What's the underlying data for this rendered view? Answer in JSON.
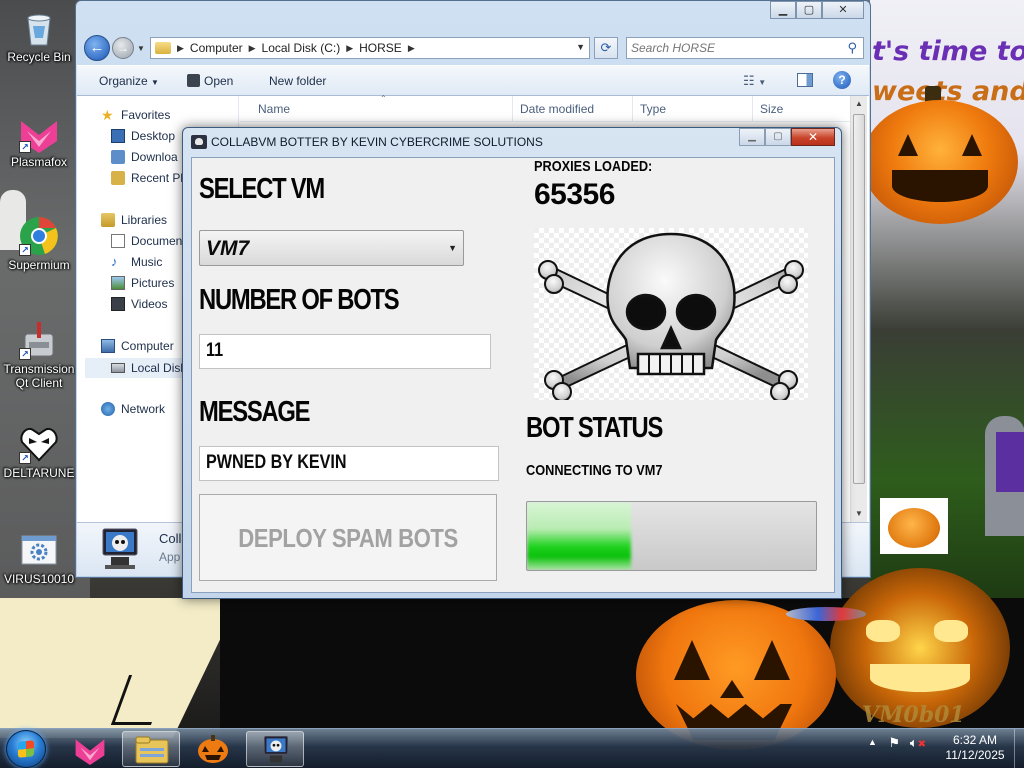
{
  "desktop": {
    "icons": [
      {
        "label": "Recycle Bin",
        "icon": "recycle-bin-icon"
      },
      {
        "label": "Plasmafox",
        "icon": "plasmafox-icon"
      },
      {
        "label": "Supermium",
        "icon": "supermium-icon"
      },
      {
        "label": "Transmission Qt Client",
        "icon": "transmission-icon"
      },
      {
        "label": "DELTARUNE",
        "icon": "deltarune-icon"
      },
      {
        "label": "VIRUS10010",
        "icon": "virus-program-icon"
      }
    ],
    "wallpaper_text": {
      "line1": "t's time to play pra",
      "line2": "weets and i",
      "watermark": "VM0b01"
    }
  },
  "explorer": {
    "address": {
      "segments": [
        "Computer",
        "Local Disk (C:)",
        "HORSE"
      ]
    },
    "search_placeholder": "Search HORSE",
    "toolbar": {
      "organize": "Organize",
      "open": "Open",
      "new_folder": "New folder"
    },
    "nav": {
      "favorites": "Favorites",
      "desktop": "Desktop",
      "downloads": "Downloa",
      "recent": "Recent Pl",
      "libraries": "Libraries",
      "documents": "Documen",
      "music": "Music",
      "pictures": "Pictures",
      "videos": "Videos",
      "computer": "Computer",
      "local_disk": "Local Disk",
      "network": "Network"
    },
    "columns": {
      "name": "Name",
      "date_modified": "Date modified",
      "type": "Type",
      "size": "Size"
    },
    "details": {
      "title": "Colla",
      "subtitle": "App"
    }
  },
  "botter": {
    "title": "COLLABVM BOTTER BY KEVIN CYBERCRIME SOLUTIONS",
    "select_vm_label": "SELECT VM",
    "selected_vm": "VM7",
    "number_of_bots_label": "NUMBER OF BOTS",
    "number_of_bots_value": "11",
    "message_label": "MESSAGE",
    "message_value": "PWNED BY KEVIN",
    "deploy_button": "DEPLOY SPAM BOTS",
    "proxies_label": "PROXIES LOADED:",
    "proxies_count": "65356",
    "bot_status_label": "BOT STATUS",
    "bot_status_text": "CONNECTING TO VM7",
    "progress_fraction": 0.36
  },
  "taskbar": {
    "time": "6:32 AM",
    "date": "11/12/2025"
  },
  "colors": {
    "progress_green": "#12c812",
    "close_red": "#c9452a"
  }
}
